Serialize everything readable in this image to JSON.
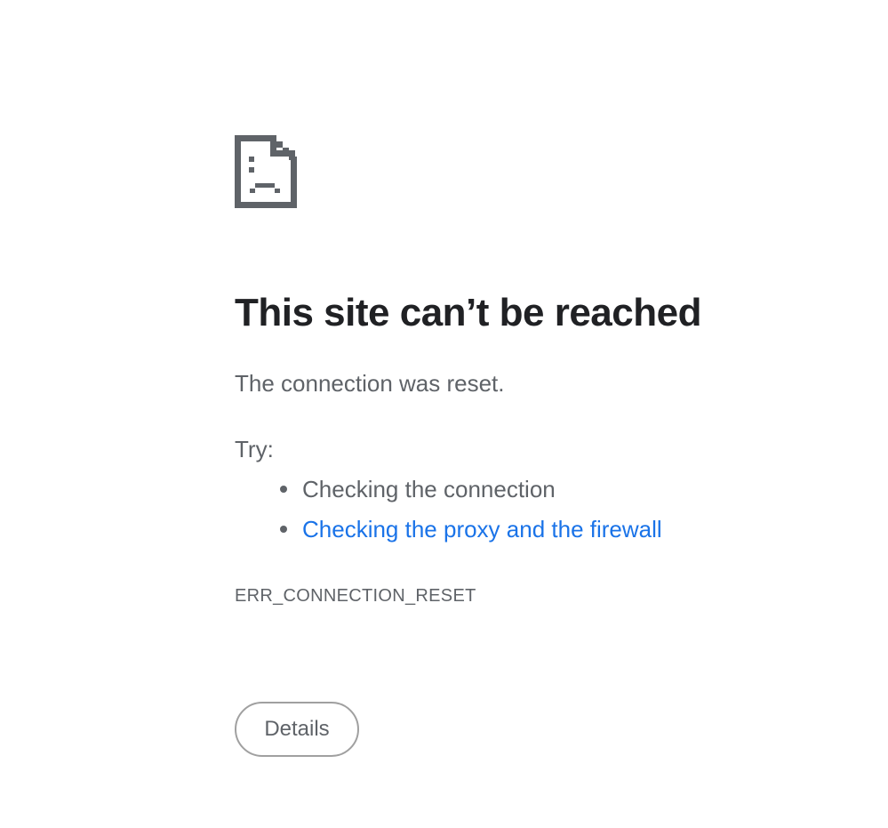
{
  "icon": "sad-document-icon",
  "heading": "This site can’t be reached",
  "description": "The connection was reset.",
  "try_label": "Try:",
  "suggestions": [
    {
      "text": "Checking the connection",
      "is_link": false
    },
    {
      "text": "Checking the proxy and the firewall",
      "is_link": true
    }
  ],
  "error_code": "ERR_CONNECTION_RESET",
  "details_button": "Details",
  "colors": {
    "heading": "#202124",
    "body_text": "#5f6368",
    "link": "#1a73e8",
    "icon": "#5f6368",
    "button_border": "#a0a0a0"
  }
}
